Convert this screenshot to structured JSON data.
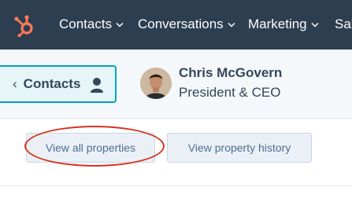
{
  "topnav": {
    "items": [
      {
        "label": "Contacts"
      },
      {
        "label": "Conversations"
      },
      {
        "label": "Marketing"
      },
      {
        "label": "Sal"
      }
    ],
    "logo_icon": "hubspot-sprocket-icon",
    "background": "#2d3e50",
    "logo_color": "#ff7a59"
  },
  "record_header": {
    "back_label": "Contacts",
    "back_icon": "chevron-left-icon",
    "contacts_icon": "person-icon",
    "contact_name": "Chris McGovern",
    "contact_title": "President & CEO",
    "accent": "#00a4bd"
  },
  "actions": {
    "view_all_label": "View all properties",
    "view_history_label": "View property history"
  },
  "annotation": {
    "highlight_color": "#d5331f"
  }
}
